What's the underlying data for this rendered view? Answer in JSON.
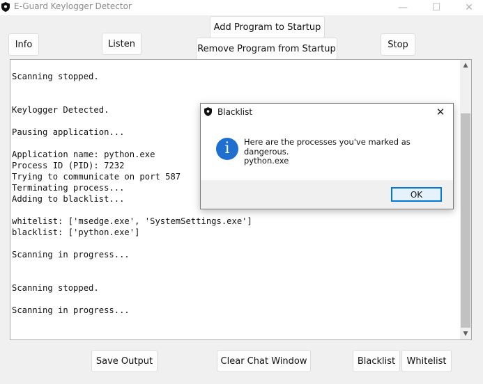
{
  "window": {
    "title": "E-Guard Keylogger Detector",
    "controls": {
      "minimize": "—",
      "maximize": "☐",
      "close": "✕"
    }
  },
  "toolbar": {
    "info": "Info",
    "listen": "Listen",
    "add_startup": "Add Program to Startup",
    "remove_startup": "Remove Program from Startup",
    "stop": "Stop"
  },
  "log": {
    "text": "Scanning stopped.\n\n\nKeylogger Detected.\n\nPausing application...\n\nApplication name: python.exe\nProcess ID (PID): 7232\nTrying to communicate on port 587\nTerminating process...\nAdding to blacklist...\n\nwhitelist: ['msedge.exe', 'SystemSettings.exe']\nblacklist: ['python.exe']\n\nScanning in progress...\n\n\nScanning stopped.\n\nScanning in progress..."
  },
  "bottom": {
    "save_output": "Save Output",
    "clear_chat": "Clear Chat Window",
    "blacklist": "Blacklist",
    "whitelist": "Whitelist"
  },
  "dialog": {
    "title": "Blacklist",
    "message": "Here are the processes you've marked as dangerous.",
    "detail": "python.exe",
    "ok": "OK",
    "icon": "i"
  },
  "colors": {
    "info_icon": "#1e6fd0",
    "default_button_border": "#0078d7",
    "default_button_fill": "#e5f1fb",
    "window_bg": "#f0f0f0"
  }
}
